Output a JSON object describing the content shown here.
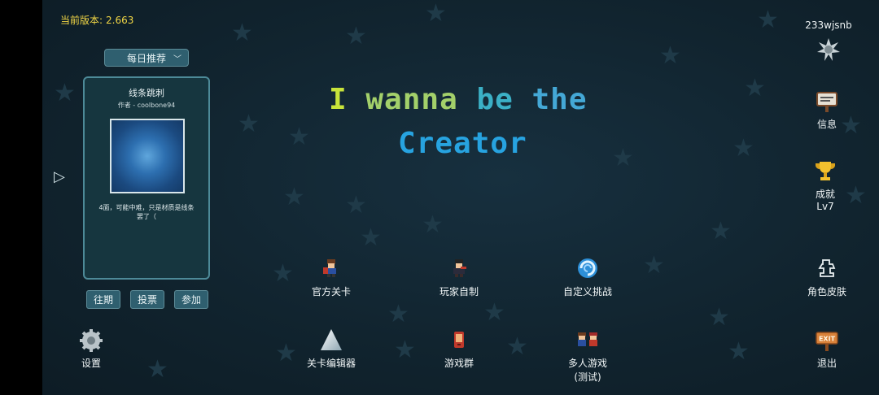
{
  "version": {
    "label": "当前版本:",
    "value": "2.663"
  },
  "featured": {
    "dropdown_label": "每日推荐",
    "card": {
      "title": "线条跳刺",
      "author": "作者 - coolbone94",
      "desc_line1": "4面，可能中难，只是材质是线条",
      "desc_line2": "罢了（"
    },
    "buttons": {
      "past": "往期",
      "vote": "投票",
      "join": "参加"
    }
  },
  "game_title": {
    "line1_words": [
      "I",
      "wanna",
      "be",
      "the"
    ],
    "line2": "Creator"
  },
  "menu": {
    "official": "官方关卡",
    "player_made": "玩家自制",
    "custom_challenge": "自定义挑战",
    "editor": "关卡编辑器",
    "group": "游戏群",
    "multiplayer_line1": "多人游戏",
    "multiplayer_line2": "(测试)"
  },
  "sidebar": {
    "username": "233wjsnb",
    "info": "信息",
    "achievements": "成就",
    "level": "Lv7",
    "skins": "角色皮肤",
    "exit": "退出",
    "exit_sign": "EXIT"
  },
  "settings": "设置",
  "colors": {
    "version_text": "#f1d645",
    "panel_bg": "#16363f",
    "panel_border": "#4d8a98",
    "button_bg": "#2f5f6f"
  }
}
